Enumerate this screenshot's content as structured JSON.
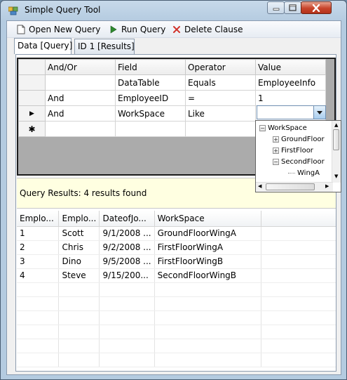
{
  "window": {
    "title": "Simple Query Tool"
  },
  "toolbar": {
    "open_label": "Open New Query",
    "run_label": "Run Query",
    "delete_label": "Delete Clause"
  },
  "tabs": [
    {
      "label": "Data [Query]",
      "active": true
    },
    {
      "label": "ID 1 [Results]",
      "active": false
    }
  ],
  "query_grid": {
    "columns": [
      "And/Or",
      "Field",
      "Operator",
      "Value"
    ],
    "rows": [
      {
        "marker": "",
        "and_or": "",
        "field": "DataTable",
        "operator": "Equals",
        "value": "EmployeeInfo"
      },
      {
        "marker": "",
        "and_or": "And",
        "field": "EmployeeID",
        "operator": "=",
        "value": "1"
      },
      {
        "marker": "▶",
        "and_or": "And",
        "field": "WorkSpace",
        "operator": "Like",
        "value": ""
      },
      {
        "marker": "✱",
        "and_or": "",
        "field": "",
        "operator": "",
        "value": ""
      }
    ]
  },
  "dropdown_tree": {
    "root": "WorkSpace",
    "children": [
      "GroundFloor",
      "FirstFloor",
      "SecondFloor"
    ],
    "grandchild": "WingA"
  },
  "results": {
    "summary": "Query Results: 4 results found",
    "columns": [
      "Emplo...",
      "Emplo...",
      "DateofJo...",
      "WorkSpace"
    ],
    "rows": [
      [
        "1",
        "Scott",
        "9/1/2008 ...",
        "GroundFloorWingA"
      ],
      [
        "2",
        "Chris",
        "9/2/2008 ...",
        "FirstFloorWingA"
      ],
      [
        "3",
        "Dino",
        "9/5/2008 ...",
        "FirstFloorWingB"
      ],
      [
        "4",
        "Steve",
        "9/15/200...",
        "SecondFloorWingB"
      ]
    ]
  },
  "colors": {
    "window_frame": "#b4cbe0",
    "close_button": "#c8442a",
    "results_banner": "#ffffe1",
    "grid_background": "#ababab"
  },
  "icons": [
    "app-icon",
    "minimize-icon",
    "maximize-icon",
    "close-icon",
    "new-document-icon",
    "play-icon",
    "delete-x-icon"
  ]
}
